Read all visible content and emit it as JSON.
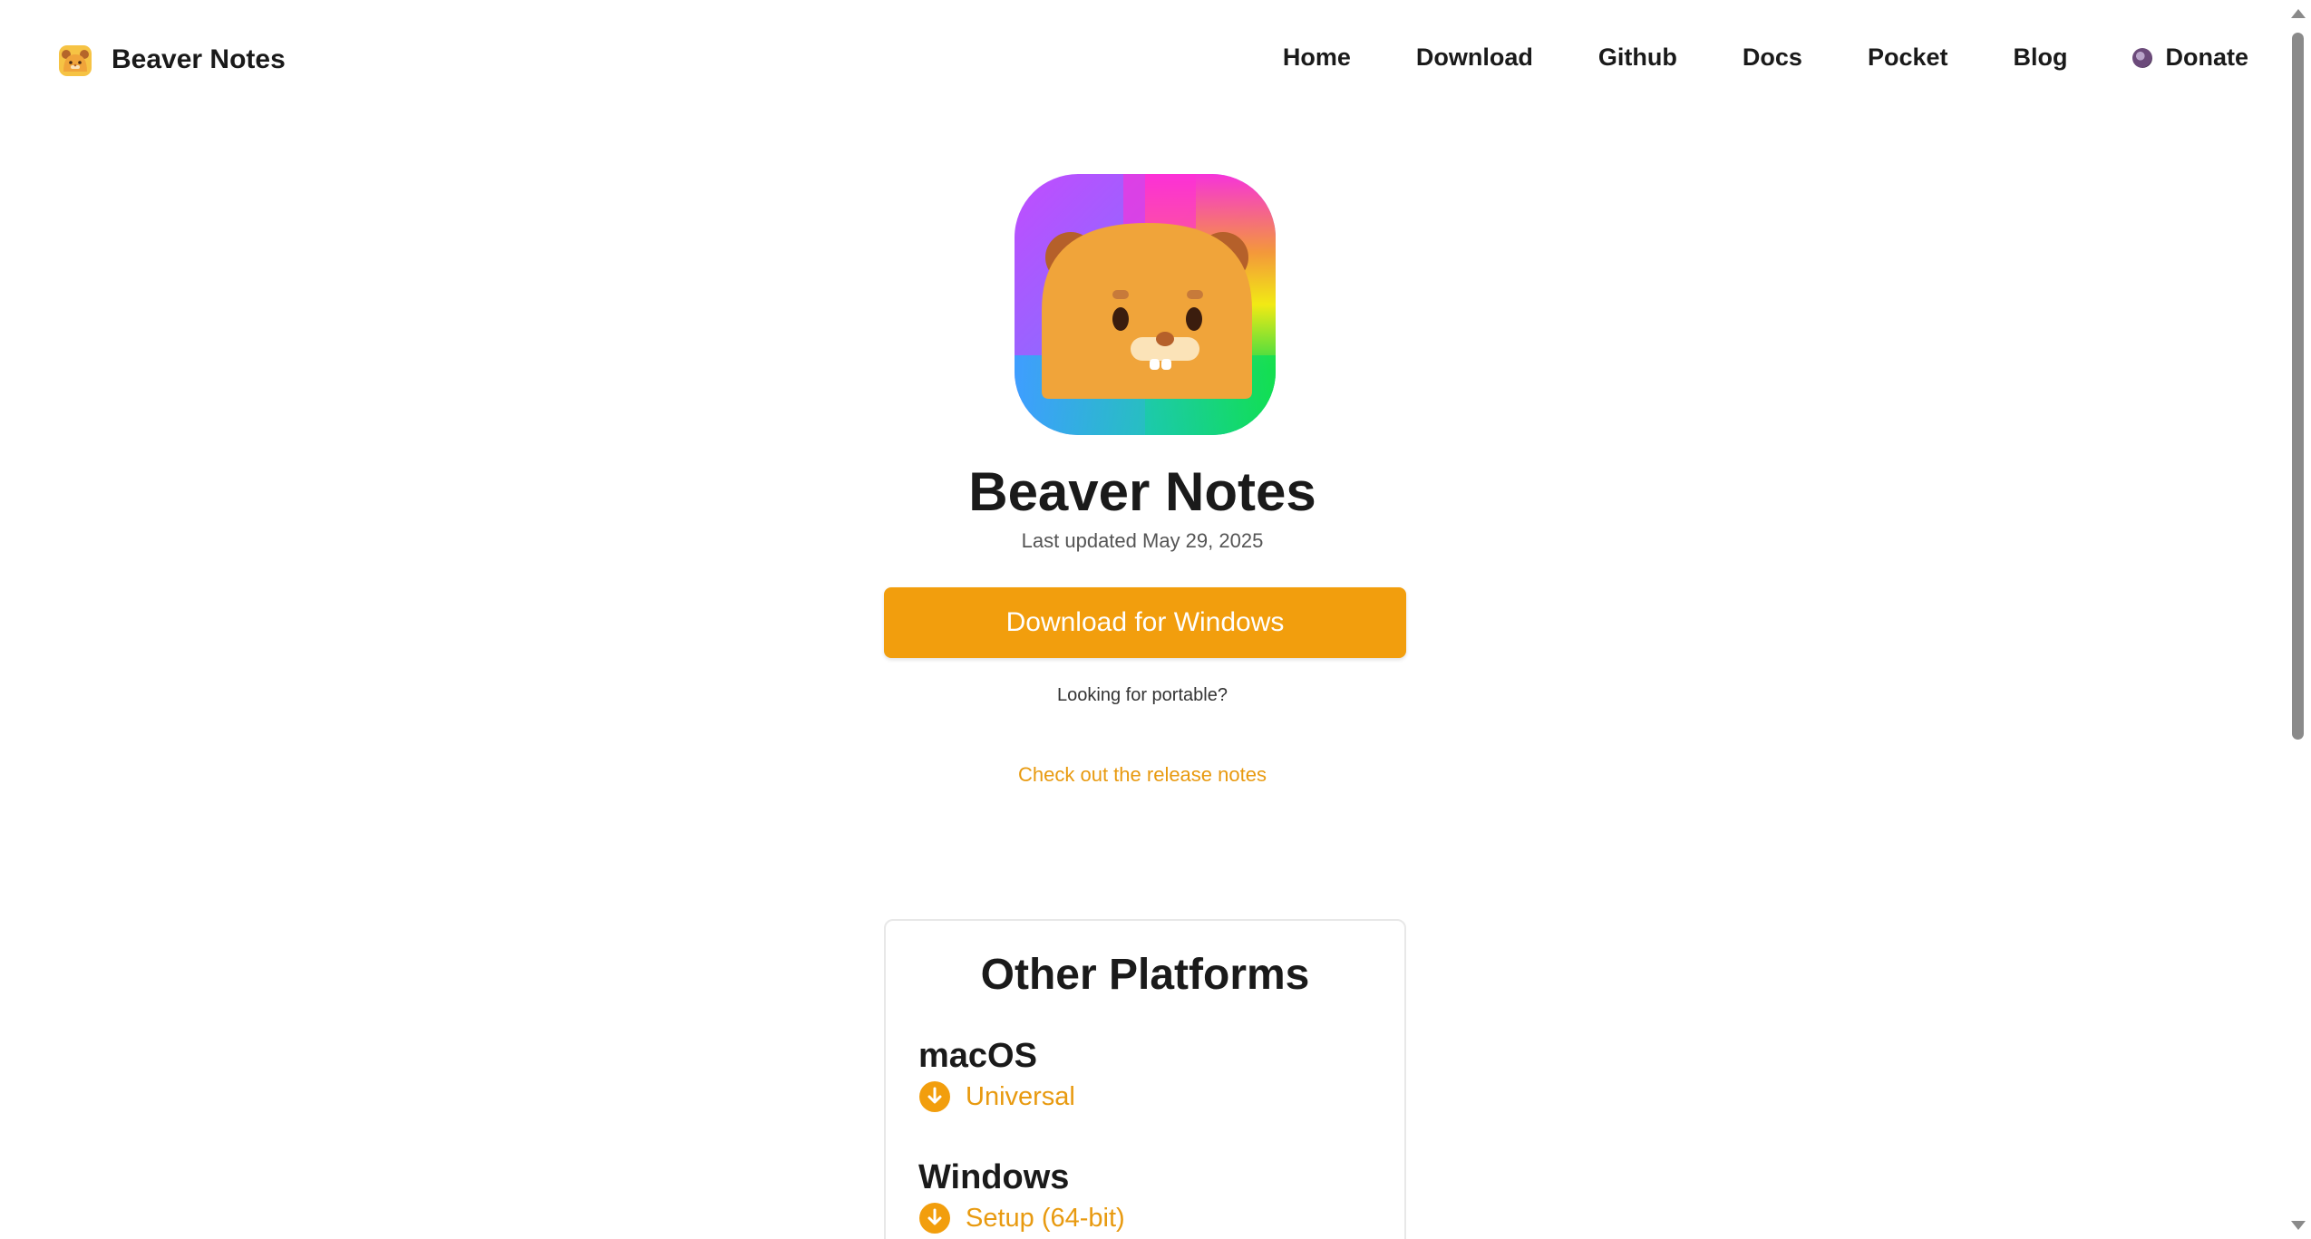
{
  "nav": {
    "brand": "Beaver Notes",
    "links": [
      {
        "label": "Home"
      },
      {
        "label": "Download"
      },
      {
        "label": "Github"
      },
      {
        "label": "Docs"
      },
      {
        "label": "Pocket"
      },
      {
        "label": "Blog"
      },
      {
        "label": "Donate"
      }
    ]
  },
  "hero": {
    "title": "Beaver Notes",
    "updated": "Last updated May 29, 2025",
    "download_label": "Download for Windows",
    "portable_text": "Looking for portable?",
    "release_notes_label": "Check out the release notes"
  },
  "other_platforms": {
    "title": "Other Platforms",
    "platforms": [
      {
        "name": "macOS",
        "link": "Universal"
      },
      {
        "name": "Windows",
        "link": "Setup (64-bit)"
      }
    ]
  },
  "colors": {
    "accent": "#f29e0d",
    "link": "#e89a10",
    "text": "#1a1a1a"
  },
  "icons": {
    "brand": "beaver-logo-icon",
    "donate": "donate-coin-icon",
    "download": "download-circle-icon"
  }
}
